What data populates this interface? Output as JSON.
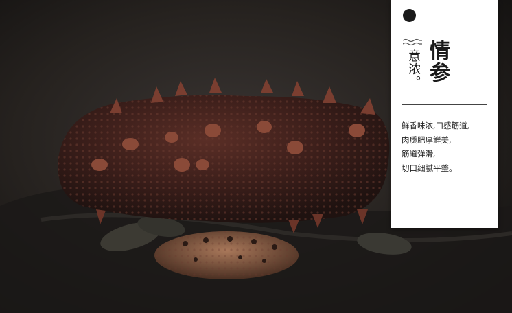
{
  "panel": {
    "title": "情参",
    "subtitle": "意浓。",
    "description": [
      "鲜香味浓,口感筋道,",
      "肉质肥厚鲜美,",
      "筋道弹滑,",
      "切口细腻平整。"
    ]
  },
  "icons": [
    "circle-dot-icon",
    "water-wave-icon"
  ],
  "colors": {
    "background": "#1c1a19",
    "panel": "#ffffff",
    "text": "#1a1a1a"
  }
}
